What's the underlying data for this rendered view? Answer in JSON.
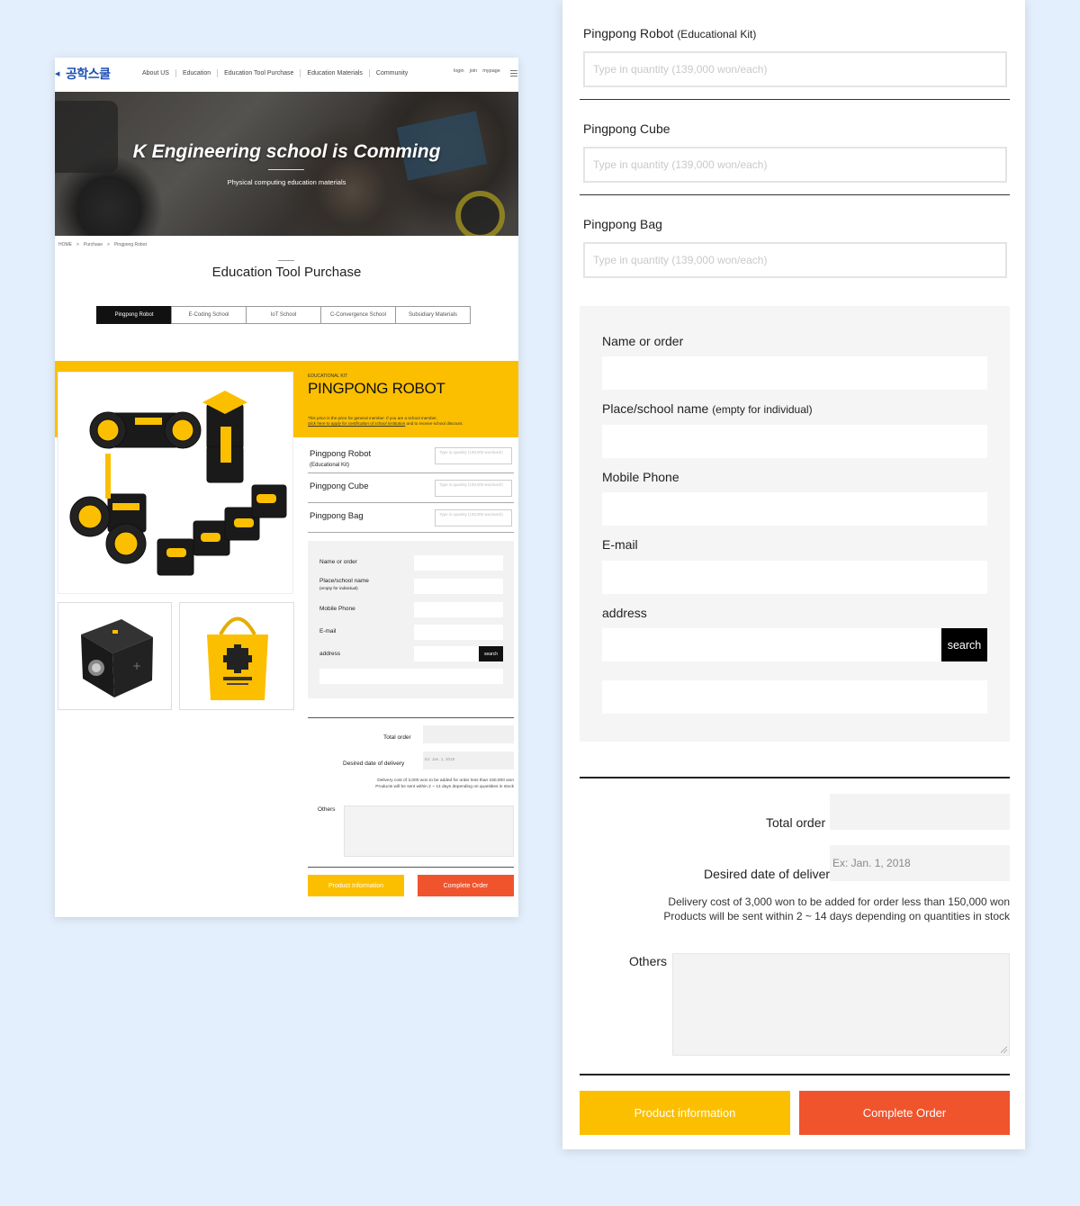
{
  "left_page": {
    "nav": {
      "logo": "공학스쿨",
      "menu": [
        "About US",
        "Education",
        "Education Tool Purchase",
        "Education Materials",
        "Community"
      ],
      "util": [
        "login",
        "join",
        "mypage"
      ]
    },
    "hero": {
      "title": "K Engineering school is Comming",
      "subtitle": "Physical computing education materials"
    },
    "breadcrumb": [
      "HOME",
      ">",
      "Purchase",
      ">",
      "Pingpong Robot"
    ],
    "page_title": "Education Tool Purchase",
    "tabs": [
      "Pingpong Robot",
      "E-Coding School",
      "IoT School",
      "C-Convergence School",
      "Subsidiary Materials"
    ],
    "active_tab": "Pingpong Robot",
    "product": {
      "kicker": "EDUCATIONAL KIT",
      "name": "PINGPONG ROBOT",
      "note_line1": "This price is the price for general member. If you are a school member,",
      "note_link": "click here to apply for certification of school institution",
      "note_line2": " and to receive school discount."
    },
    "items": [
      {
        "name": "Pingpong Robot",
        "sub": "(Educational Kit)",
        "placeholder": "Type in quantity (139,000 won/each)"
      },
      {
        "name": "Pingpong Cube",
        "sub": "",
        "placeholder": "Type in quantity (139,000 won/each)"
      },
      {
        "name": "Pingpong Bag",
        "sub": "",
        "placeholder": "Type in quantity (139,000 won/each)"
      }
    ],
    "form": {
      "name": "Name or order",
      "place": "Place/school name",
      "place_sub": "(empty for individual)",
      "phone": "Mobile Phone",
      "email": "E-mail",
      "address": "address",
      "search": "search"
    },
    "total_label": "Total order",
    "date_label": "Desired date of delivery",
    "date_placeholder": "Ex: Jan. 1, 2018",
    "note1": "Delivery cost of 3,000 won to be added for order less than 150,000 won",
    "note2": "Products will be sent within 2 ~ 14 days depending on quantities in stock",
    "others_label": "Others",
    "btn_info": "Product Information",
    "btn_complete": "Complete Order"
  },
  "right_panel": {
    "items": [
      {
        "name": "Pingpong Robot",
        "sub": "(Educational Kit)",
        "placeholder": "Type in quantity (139,000 won/each)"
      },
      {
        "name": "Pingpong Cube",
        "sub": "",
        "placeholder": "Type in quantity (139,000 won/each)"
      },
      {
        "name": "Pingpong Bag",
        "sub": "",
        "placeholder": "Type in quantity (139,000 won/each)"
      }
    ],
    "form": {
      "name": "Name or order",
      "place": "Place/school name",
      "place_sub": "(empty for individual)",
      "phone": "Mobile Phone",
      "email": "E-mail",
      "address": "address",
      "search": "search"
    },
    "total_label": "Total order",
    "date_label": "Desired date of delivery",
    "date_placeholder": "Ex: Jan. 1, 2018",
    "note1": "Delivery cost of 3,000 won to be added for order less than 150,000 won",
    "note2": "Products will be sent within 2 ~ 14 days depending on quantities in stock",
    "others_label": "Others",
    "btn_info": "Product information",
    "btn_complete": "Complete Order"
  },
  "colors": {
    "background": "#e3effc",
    "yellow": "#fcbf00",
    "orange": "#f0542d",
    "brand_blue": "#1c4fb3",
    "black": "#000000"
  }
}
